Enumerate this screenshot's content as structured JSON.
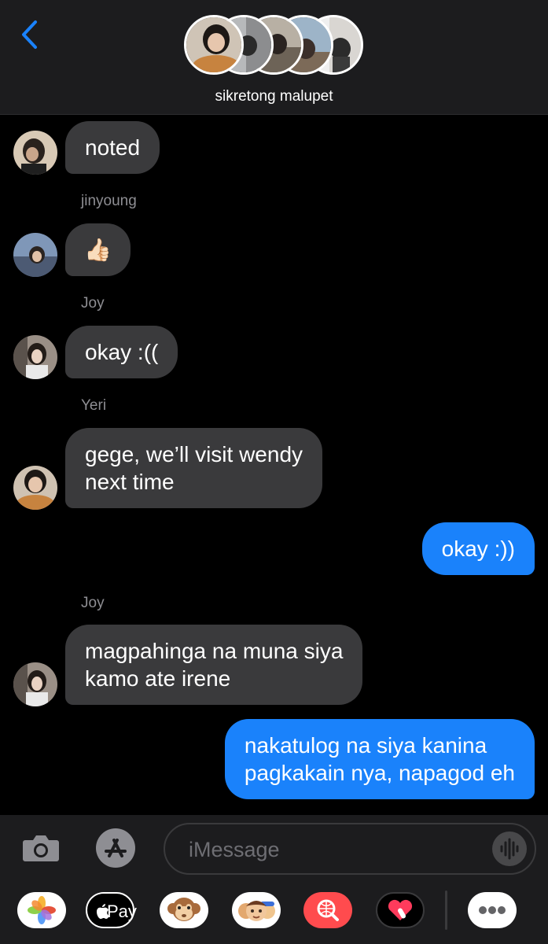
{
  "header": {
    "group_name": "sikretong malupet"
  },
  "messages": [
    {
      "sender": "",
      "text": "noted",
      "direction": "incoming"
    },
    {
      "sender": "jinyoung",
      "text": "👍🏻",
      "direction": "incoming"
    },
    {
      "sender": "Joy",
      "text": "okay :((",
      "direction": "incoming"
    },
    {
      "sender": "Yeri",
      "line1": "gege, we’ll visit wendy",
      "line2": "next time",
      "direction": "incoming"
    },
    {
      "sender": "",
      "text": "okay :))",
      "direction": "outgoing"
    },
    {
      "sender": "Joy",
      "line1": "magpahinga na muna siya",
      "line2": "kamo ate irene",
      "direction": "incoming"
    },
    {
      "sender": "",
      "line1": "nakatulog na siya kanina",
      "line2": "pagkakain nya, napagod eh",
      "direction": "outgoing"
    }
  ],
  "input": {
    "placeholder": "iMessage"
  },
  "app_drawer": {
    "apple_pay_label": "Pay",
    "apps": [
      "photos-icon",
      "apple-pay-icon",
      "animoji-icon",
      "memoji-icon",
      "web-search-icon",
      "digital-touch-icon",
      "more-icon"
    ]
  },
  "colors": {
    "outgoing_bubble": "#1a82fb",
    "incoming_bubble": "#3a3a3c",
    "accent": "#1a82fb"
  }
}
